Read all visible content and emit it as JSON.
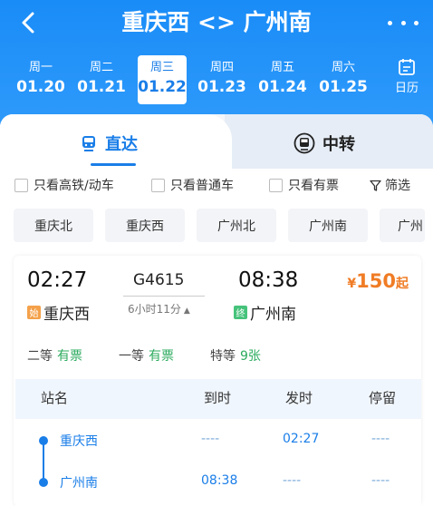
{
  "header": {
    "title": "重庆西 <> 广州南"
  },
  "dates": [
    {
      "weekday": "周一",
      "date": "01.20"
    },
    {
      "weekday": "周二",
      "date": "01.21"
    },
    {
      "weekday": "周三",
      "date": "01.22"
    },
    {
      "weekday": "周四",
      "date": "01.23"
    },
    {
      "weekday": "周五",
      "date": "01.24"
    },
    {
      "weekday": "周六",
      "date": "01.25"
    }
  ],
  "selected_date_index": 2,
  "calendar_label": "日历",
  "tabs": {
    "direct": "直达",
    "transfer": "中转"
  },
  "filters": {
    "high_speed": "只看高铁/动车",
    "regular": "只看普通车",
    "has_ticket": "只看有票",
    "filter": "筛选"
  },
  "stations": [
    "重庆北",
    "重庆西",
    "广州北",
    "广州南",
    "广州"
  ],
  "train": {
    "dep_time": "02:27",
    "arr_time": "08:38",
    "number": "G4615",
    "duration": "6小时11分",
    "from_badge": "始",
    "from": "重庆西",
    "to_badge": "终",
    "to": "广州南",
    "price_symbol": "¥",
    "price": "150",
    "price_suffix": "起",
    "seats": [
      {
        "class": "二等",
        "status": "有票"
      },
      {
        "class": "一等",
        "status": "有票"
      },
      {
        "class": "特等",
        "status": "9张"
      }
    ]
  },
  "stops_header": {
    "station": "站名",
    "arrive": "到时",
    "depart": "发时",
    "stay": "停留"
  },
  "stops": [
    {
      "name": "重庆西",
      "arrive": "----",
      "depart": "02:27",
      "stay": "----"
    },
    {
      "name": "广州南",
      "arrive": "08:38",
      "depart": "----",
      "stay": "----"
    }
  ],
  "colors": {
    "primary": "#1a7ee8",
    "price": "#f07c25",
    "available": "#2bab5e"
  }
}
